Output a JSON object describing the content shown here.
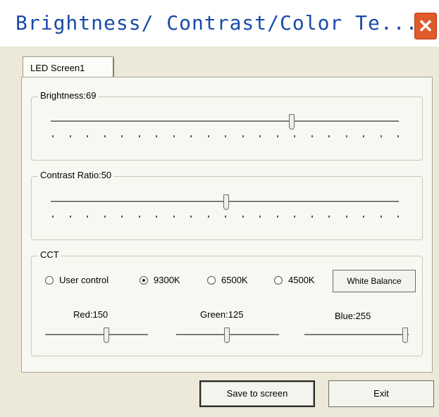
{
  "window": {
    "title": "Brightness/ Contrast/Color Te...",
    "close_glyph": "✕"
  },
  "tabs": [
    {
      "label": "LED Screen1",
      "selected": true
    }
  ],
  "brightness": {
    "label": "Brightness:69",
    "value": 69,
    "min": 0,
    "max": 100
  },
  "contrast": {
    "label": "Contrast Ratio:50",
    "value": 50,
    "min": 0,
    "max": 100
  },
  "cct": {
    "label": "CCT",
    "options": [
      {
        "label": "User control",
        "checked": false
      },
      {
        "label": "9300K",
        "checked": true
      },
      {
        "label": "6500K",
        "checked": false
      },
      {
        "label": "4500K",
        "checked": false
      }
    ],
    "white_balance_label": "White Balance",
    "red": {
      "label": "Red:150",
      "value": 150,
      "max": 255
    },
    "green": {
      "label": "Green:125",
      "value": 125,
      "max": 255
    },
    "blue": {
      "label": "Blue:255",
      "value": 255,
      "max": 255
    }
  },
  "buttons": {
    "save_label": "Save to screen",
    "exit_label": "Exit"
  }
}
